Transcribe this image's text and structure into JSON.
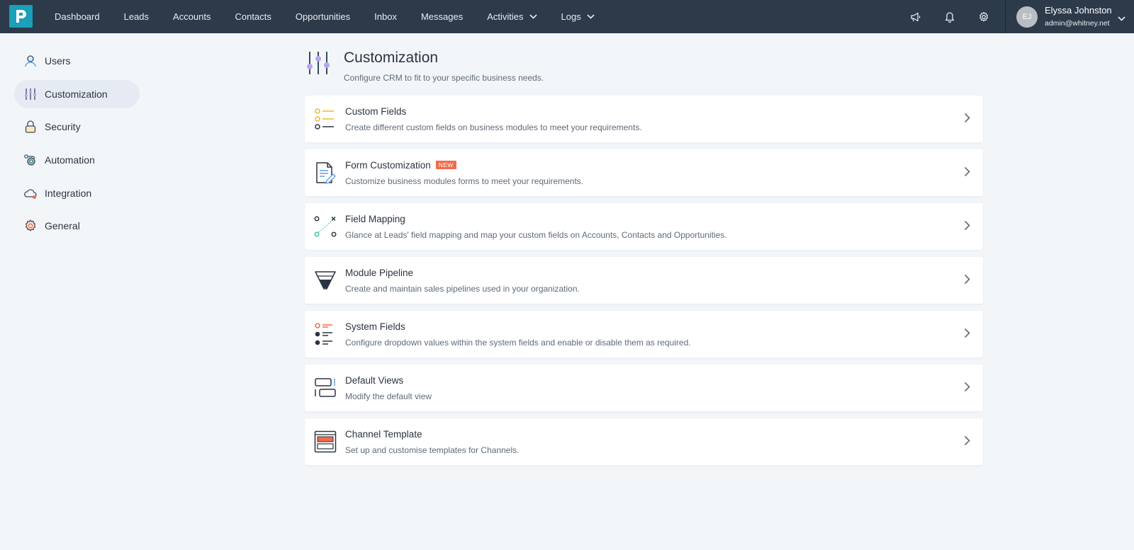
{
  "nav": {
    "items": [
      {
        "label": "Dashboard"
      },
      {
        "label": "Leads"
      },
      {
        "label": "Accounts"
      },
      {
        "label": "Contacts"
      },
      {
        "label": "Opportunities"
      },
      {
        "label": "Inbox"
      },
      {
        "label": "Messages"
      },
      {
        "label": "Activities"
      },
      {
        "label": "Logs"
      }
    ]
  },
  "user": {
    "initials": "EJ",
    "name": "Elyssa Johnston",
    "email": "admin@whitney.net"
  },
  "sidebar": {
    "items": [
      {
        "label": "Users",
        "icon": "user-icon"
      },
      {
        "label": "Customization",
        "icon": "sliders-icon",
        "active": true
      },
      {
        "label": "Security",
        "icon": "lock-icon"
      },
      {
        "label": "Automation",
        "icon": "automation-icon"
      },
      {
        "label": "Integration",
        "icon": "cloud-icon"
      },
      {
        "label": "General",
        "icon": "gear-icon"
      }
    ]
  },
  "page": {
    "title": "Customization",
    "subtitle": "Configure CRM to fit to your specific business needs."
  },
  "cards": [
    {
      "title": "Custom Fields",
      "desc": "Create different custom fields on business modules to meet your requirements."
    },
    {
      "title": "Form Customization",
      "badge": "NEW",
      "desc": "Customize business modules forms to meet your requirements."
    },
    {
      "title": "Field Mapping",
      "desc": "Glance at Leads' field mapping and map your custom fields on Accounts, Contacts and Opportunities."
    },
    {
      "title": "Module Pipeline",
      "desc": "Create and maintain sales pipelines used in your organization."
    },
    {
      "title": "System Fields",
      "desc": "Configure dropdown values within the system fields and enable or disable them as required."
    },
    {
      "title": "Default Views",
      "desc": "Modify the default view"
    },
    {
      "title": "Channel Template",
      "desc": "Set up and customise templates for Channels."
    }
  ],
  "colors": {
    "topbar": "#2c3a4a",
    "logo": "#1aa0b8",
    "badge": "#f36b4b",
    "active_side": "#e6ebf3"
  }
}
